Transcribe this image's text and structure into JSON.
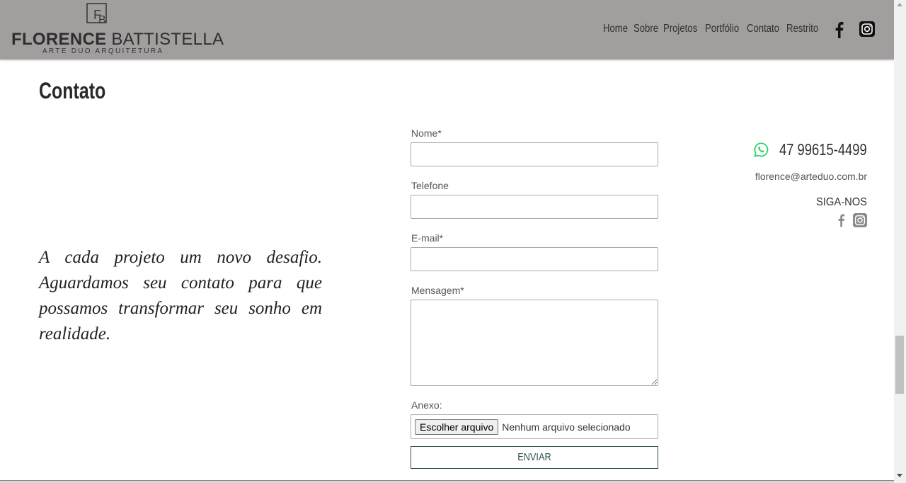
{
  "header": {
    "logo": {
      "name_bold": "FLORENCE",
      "name_light": "BATTISTELLA",
      "tagline": "ARTE DUO ARQUITETURA",
      "monogram": "FB"
    },
    "nav": [
      "Home",
      "Sobre",
      "Projetos",
      "Portfólio",
      "Contato",
      "Restrito"
    ],
    "social_icons": [
      "facebook-icon",
      "instagram-icon"
    ]
  },
  "main": {
    "title": "Contato",
    "quote": "A cada projeto um novo desafio. Aguardamos seu contato para que possamos transformar seu sonho em realidade."
  },
  "form": {
    "name_label": "Nome*",
    "name_value": "",
    "phone_label": "Telefone",
    "phone_value": "",
    "email_label": "E-mail*",
    "email_value": "",
    "message_label": "Mensagem*",
    "message_value": "",
    "attachment_label": "Anexo:",
    "file_button": "Escolher arquivo",
    "file_status": "Nenhum arquivo selecionado",
    "submit": "ENVIAR"
  },
  "contact": {
    "phone": "47 99615-4499",
    "email": "florence@arteduo.com.br",
    "follow": "SIGA-NOS"
  },
  "colors": {
    "header_bg": "#a29e9e",
    "whatsapp": "#25d366",
    "button_border": "#2f4f4f"
  }
}
